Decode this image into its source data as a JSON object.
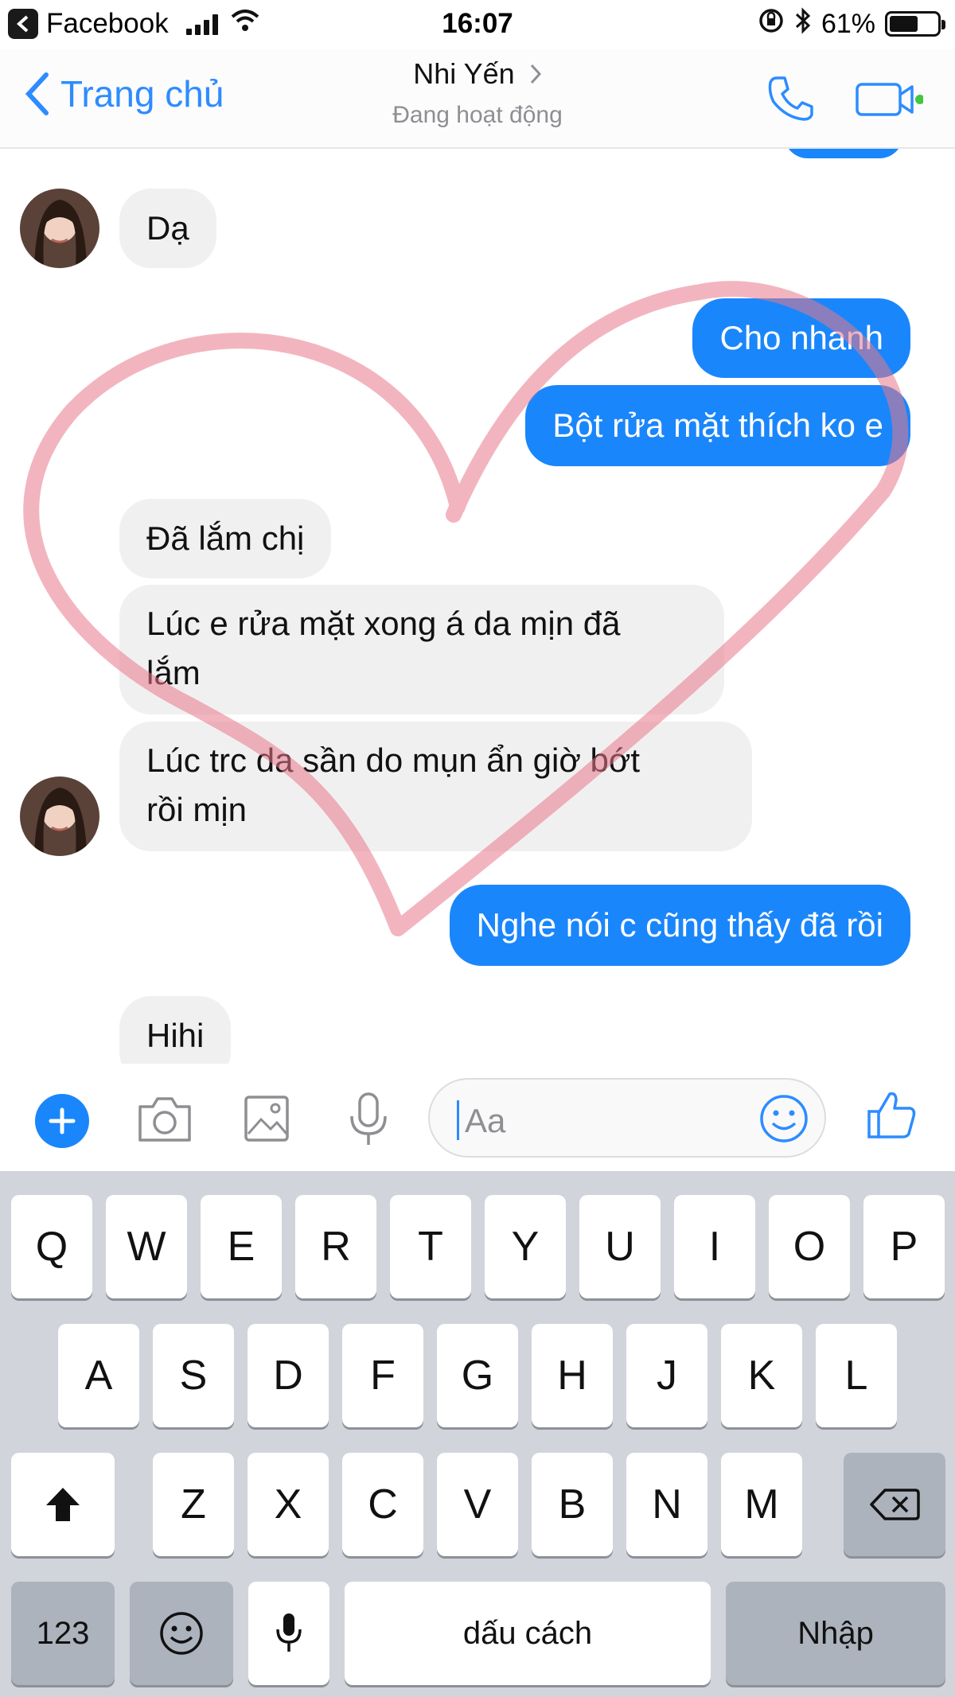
{
  "status_bar": {
    "carrier": "Facebook",
    "time": "16:07",
    "battery": "61%",
    "battery_level": 0.61
  },
  "header": {
    "back_label": "Trang chủ",
    "contact_name": "Nhi Yến",
    "contact_status": "Đang hoạt động",
    "icons": [
      "phone-icon",
      "video-icon"
    ]
  },
  "messages": [
    {
      "side": "in",
      "text": "Dạ"
    },
    {
      "side": "out",
      "text": "Cho nhanh"
    },
    {
      "side": "out",
      "text": "Bột rửa mặt thích ko e"
    },
    {
      "side": "in",
      "text": "Đã lắm chị"
    },
    {
      "side": "in",
      "line1": "Lúc e rửa mặt xong á da mịn đã",
      "line2": "lắm"
    },
    {
      "side": "in",
      "line1": "Lúc trc da sần do mụn ẩn giờ bớt",
      "line2": "rồi mịn"
    },
    {
      "side": "out",
      "text": "Nghe nói c cũng thấy đã rồi"
    },
    {
      "side": "in",
      "text": "Hihi"
    }
  ],
  "composer": {
    "placeholder": "Aa",
    "icons": [
      "plus-icon",
      "camera-icon",
      "image-icon",
      "microphone-icon",
      "emoji-icon",
      "thumbs-up-icon"
    ]
  },
  "keyboard": {
    "row1": [
      "Q",
      "W",
      "E",
      "R",
      "T",
      "Y",
      "U",
      "I",
      "O",
      "P"
    ],
    "row2": [
      "A",
      "S",
      "D",
      "F",
      "G",
      "H",
      "J",
      "K",
      "L"
    ],
    "row3": [
      "Z",
      "X",
      "C",
      "V",
      "B",
      "N",
      "M"
    ],
    "numbers_label": "123",
    "space_label": "dấu cách",
    "return_label": "Nhập"
  },
  "colors": {
    "accent": "#1a86fb",
    "heart_overlay": "#e8788a"
  }
}
